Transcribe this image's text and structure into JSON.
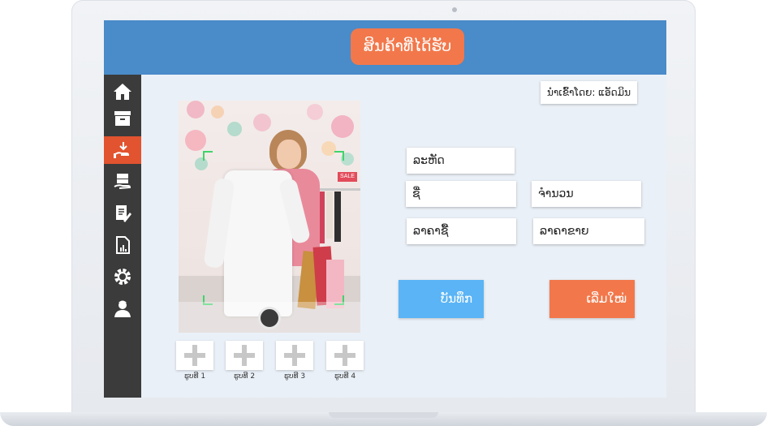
{
  "header": {
    "title": "ສິນຄ້າທີ່ໄດ້ຮັບ"
  },
  "sidebar": {
    "items": [
      {
        "icon": "home-icon",
        "active": false
      },
      {
        "icon": "archive-box-icon",
        "active": false
      },
      {
        "icon": "receive-goods-icon",
        "active": true
      },
      {
        "icon": "stock-hand-icon",
        "active": false
      },
      {
        "icon": "document-edit-icon",
        "active": false
      },
      {
        "icon": "report-chart-icon",
        "active": false
      },
      {
        "icon": "gear-icon",
        "active": false
      },
      {
        "icon": "user-icon",
        "active": false
      }
    ]
  },
  "imported_by": "ນຳເຂົ້າໂດຍ: ແອັດມິນ",
  "form": {
    "code_placeholder": "ລະຫັດ",
    "name_placeholder": "ຊື່",
    "quantity_placeholder": "ຈຳນວນ",
    "cost_price_placeholder": "ລາຄາຊື້",
    "sell_price_placeholder": "ລາຄາຂາຍ"
  },
  "buttons": {
    "save": "ບັນທຶກ",
    "reset": "ເລີ່ມໃໝ່"
  },
  "thumbnails": [
    "ຮູບທີ 1",
    "ຮູບທີ 2",
    "ຮູບທີ 3",
    "ຮູບທີ 4"
  ],
  "colors": {
    "header": "#4a8bc9",
    "accent": "#f2784b",
    "save": "#5ab4f5",
    "sidebar": "#3b3b3b"
  }
}
